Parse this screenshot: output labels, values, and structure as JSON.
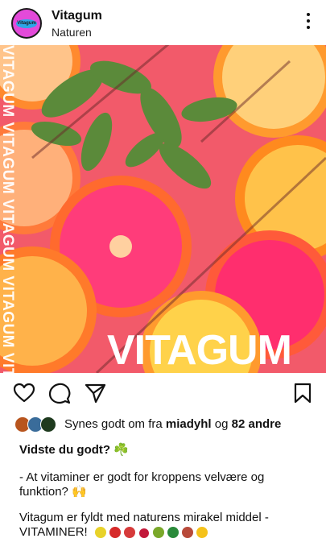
{
  "account": {
    "name": "Vitagum",
    "location": "Naturen",
    "avatar_text": "Vitagum"
  },
  "post": {
    "brand_overlay": "VITAGUM",
    "side_overlay": "VITAGUM VITAGUM VITAGUM VITAGUM VITAGUM"
  },
  "likes": {
    "prefix": "Synes godt om fra ",
    "user": "miadyhl",
    "middle": " og ",
    "others": "82 andre"
  },
  "caption": {
    "title": "Vidste du godt? ☘️",
    "line1": "- At vitaminer er godt for kroppens velvære og funktion? 🙌",
    "line2": "Vitagum er fyldt med naturens mirakel middel - VITAMINER!"
  },
  "icons": {
    "more": "more-options-icon",
    "like": "heart-icon",
    "comment": "comment-icon",
    "share": "share-icon",
    "save": "bookmark-icon"
  },
  "colors": {
    "avatar_bg": "#e34ad9",
    "avatar_accent": "#2ea6e8",
    "image_overlay": "#ffffff"
  }
}
